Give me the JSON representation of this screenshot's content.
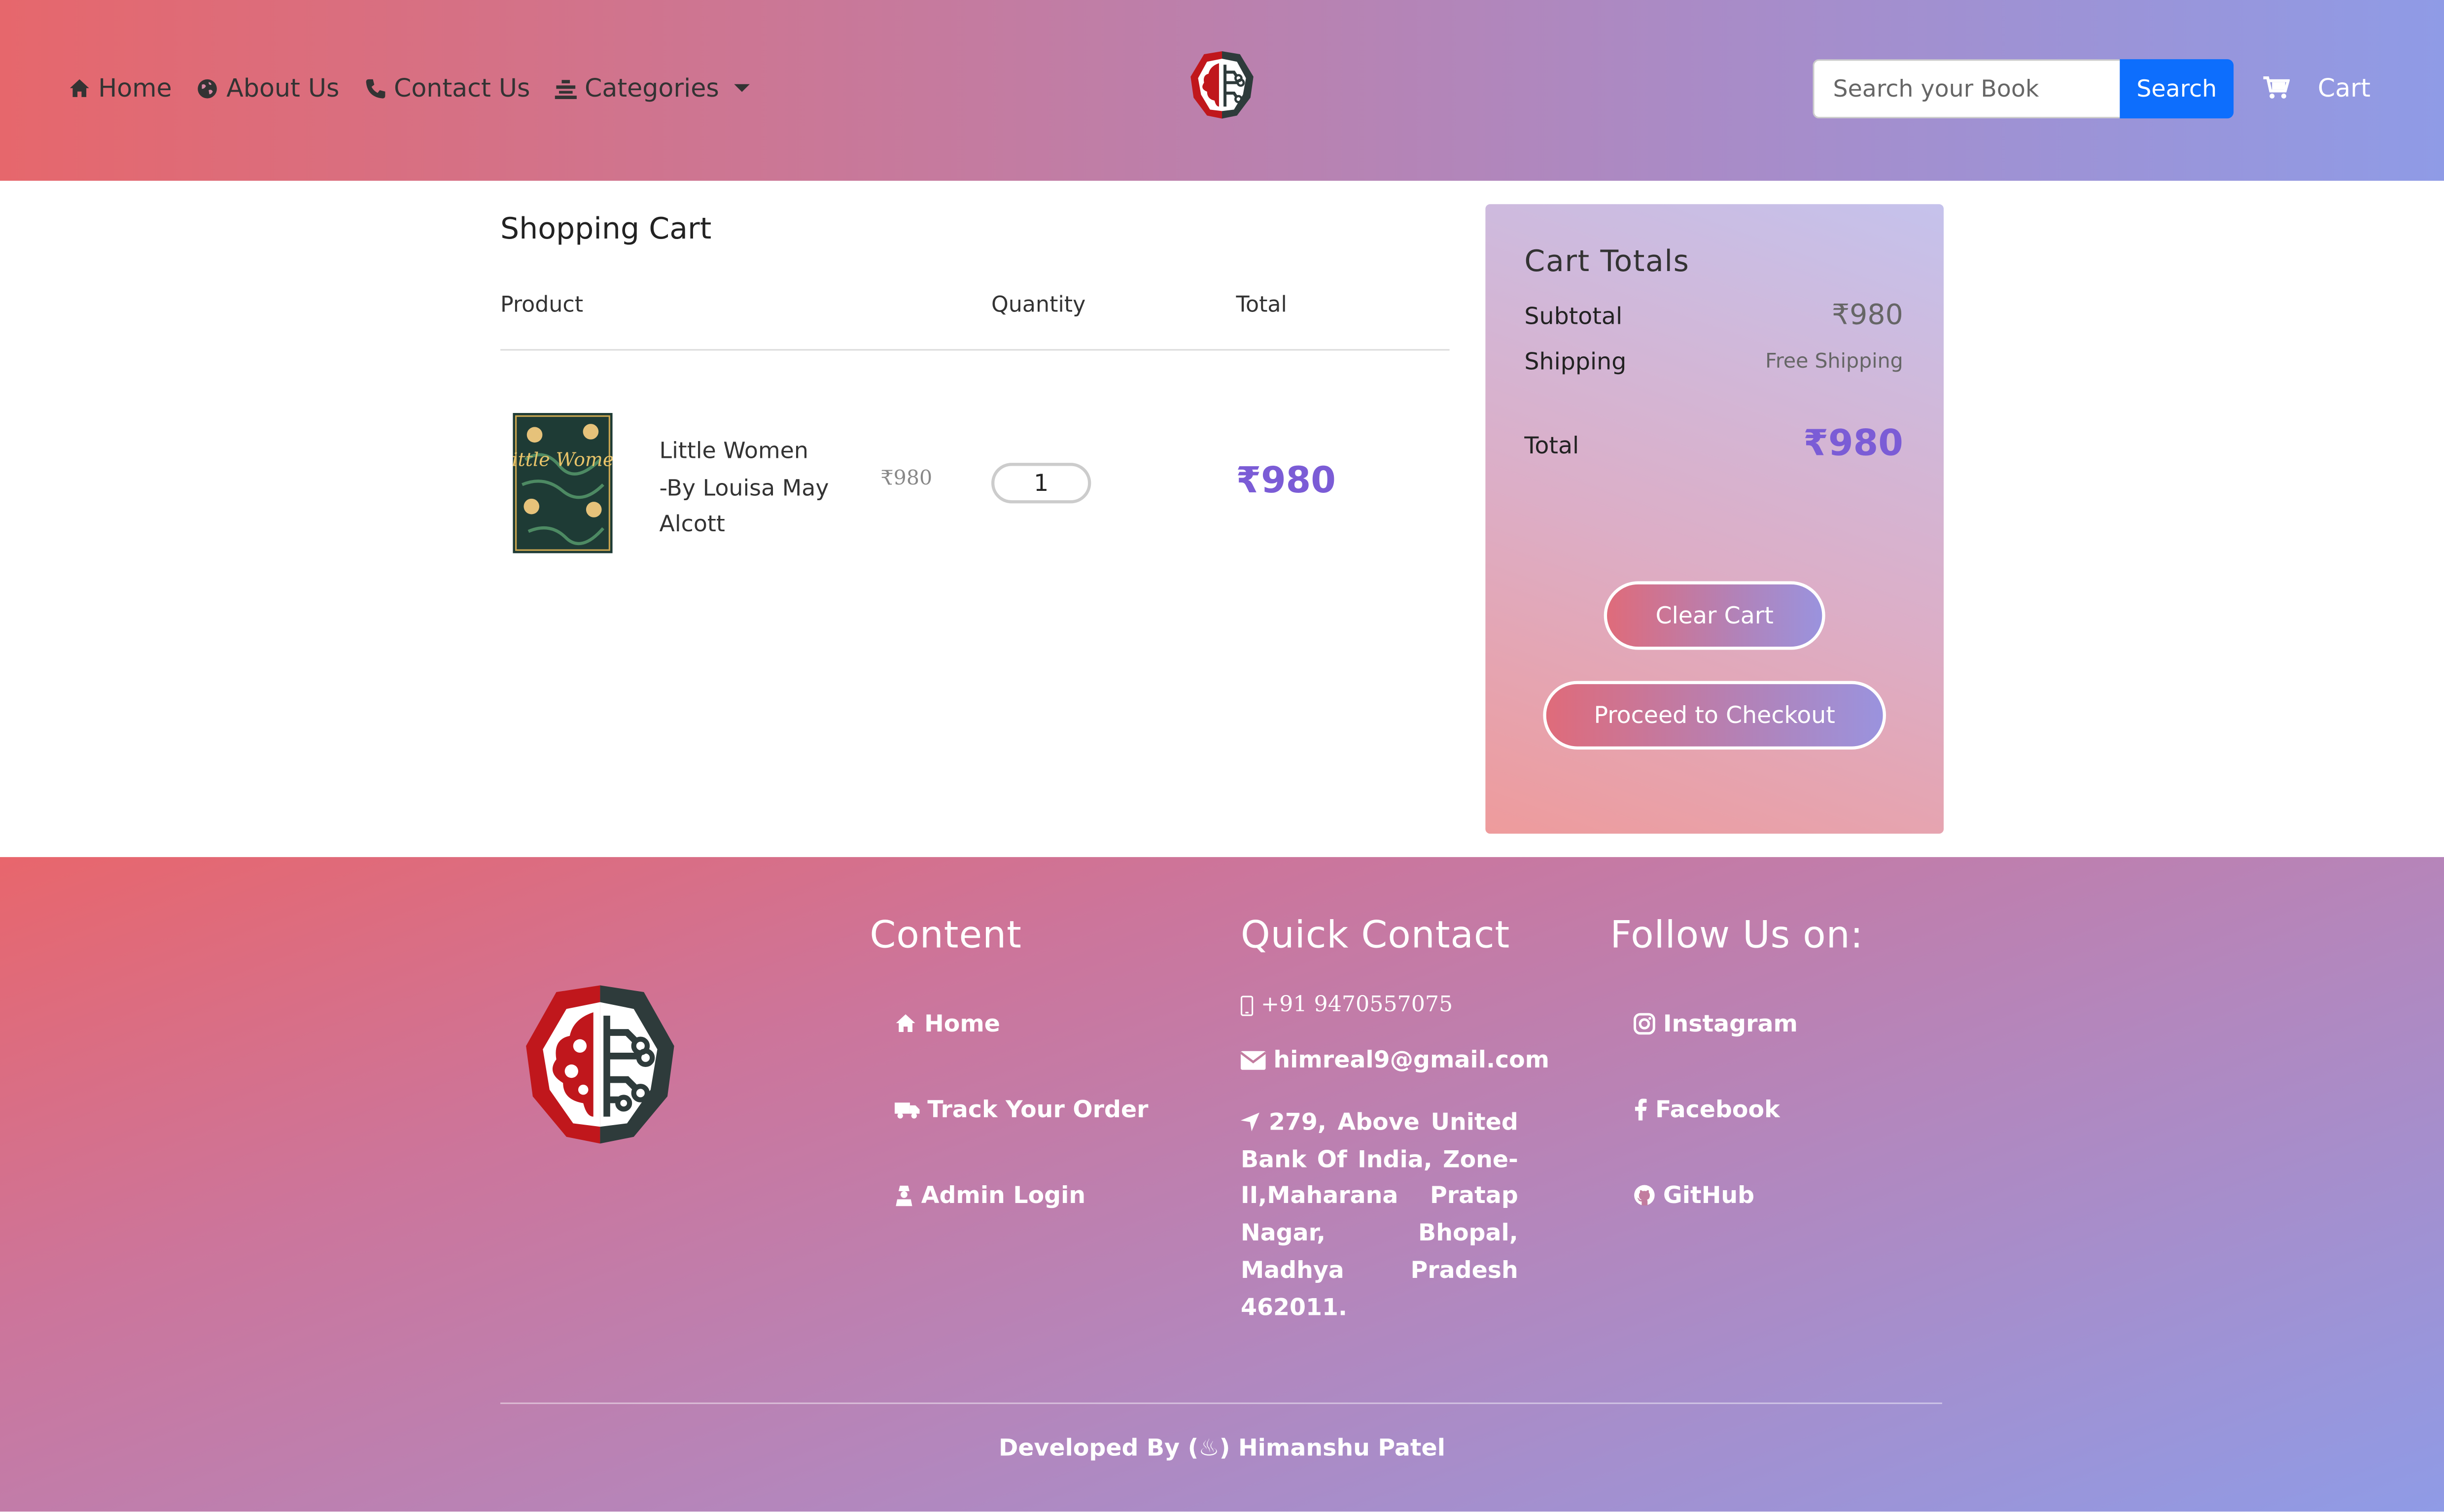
{
  "nav": {
    "items": [
      {
        "label": "Home",
        "icon": "home-icon"
      },
      {
        "label": "About Us",
        "icon": "globe-icon"
      },
      {
        "label": "Contact Us",
        "icon": "phone-icon"
      },
      {
        "label": "Categories",
        "icon": "categories-icon"
      }
    ]
  },
  "search": {
    "placeholder": "Search your Book",
    "button_label": "Search"
  },
  "cart_link": {
    "label": "Cart",
    "icon": "cart-icon"
  },
  "cart": {
    "title": "Shopping Cart",
    "columns": [
      "Product",
      "Quantity",
      "Total"
    ],
    "items": [
      {
        "name_lines": [
          "Little Women",
          "-By Louisa May",
          "Alcott"
        ],
        "unit_price": "₹980",
        "quantity": "1",
        "total": "₹980",
        "cover_text": "Little Women"
      }
    ]
  },
  "totals": {
    "title": "Cart Totals",
    "subtotal_label": "Subtotal",
    "subtotal_value": "₹980",
    "shipping_label": "Shipping",
    "shipping_value": "Free Shipping",
    "total_label": "Total",
    "total_value": "₹980",
    "clear_label": "Clear Cart",
    "checkout_label": "Proceed to Checkout"
  },
  "footer": {
    "content": {
      "title": "Content",
      "links": [
        "Home",
        "Track Your Order",
        "Admin Login"
      ]
    },
    "contact": {
      "title": "Quick Contact",
      "phone": "+91 9470557075",
      "email": "himreal9@gmail.com",
      "address": "279, Above United Bank Of India, Zone-II,Maharana Pratap Nagar, Bhopal, Madhya Pradesh 462011."
    },
    "follow": {
      "title": "Follow Us on:",
      "links": [
        "Instagram",
        "Facebook",
        "GitHub"
      ]
    },
    "credit": "Developed By (♨) Himanshu Patel"
  },
  "colors": {
    "accent": "#7b5cd6",
    "search_button": "#0d6efd",
    "brand_red": "#c0171c",
    "brand_dark": "#2e3b3b"
  }
}
